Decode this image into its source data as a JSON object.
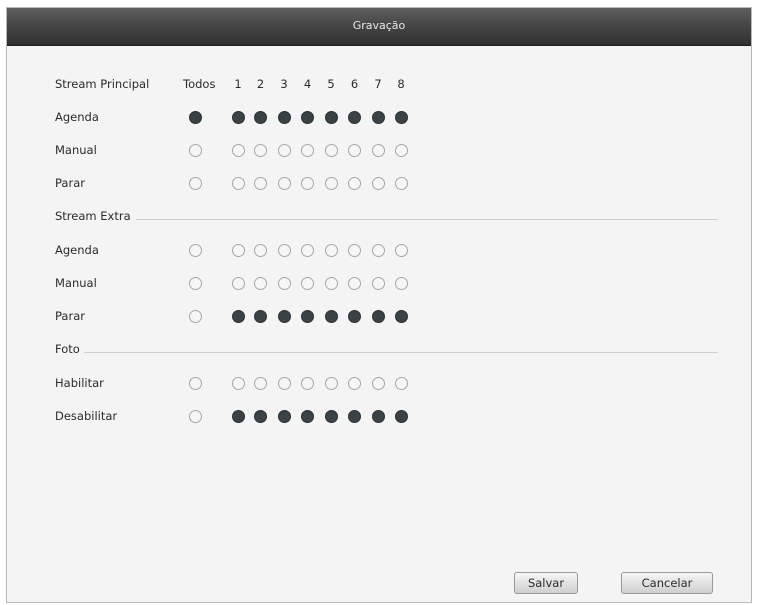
{
  "window": {
    "title": "Gravação"
  },
  "header": {
    "stream_label": "Stream Principal",
    "todos_label": "Todos",
    "channels": [
      "1",
      "2",
      "3",
      "4",
      "5",
      "6",
      "7",
      "8"
    ]
  },
  "main_stream": {
    "rows": [
      {
        "label": "Agenda",
        "todos": true,
        "channels": [
          true,
          true,
          true,
          true,
          true,
          true,
          true,
          true
        ]
      },
      {
        "label": "Manual",
        "todos": false,
        "channels": [
          false,
          false,
          false,
          false,
          false,
          false,
          false,
          false
        ]
      },
      {
        "label": "Parar",
        "todos": false,
        "channels": [
          false,
          false,
          false,
          false,
          false,
          false,
          false,
          false
        ]
      }
    ]
  },
  "extra_stream": {
    "section_label": "Stream Extra",
    "rows": [
      {
        "label": "Agenda",
        "todos": false,
        "channels": [
          false,
          false,
          false,
          false,
          false,
          false,
          false,
          false
        ]
      },
      {
        "label": "Manual",
        "todos": false,
        "channels": [
          false,
          false,
          false,
          false,
          false,
          false,
          false,
          false
        ]
      },
      {
        "label": "Parar",
        "todos": false,
        "channels": [
          true,
          true,
          true,
          true,
          true,
          true,
          true,
          true
        ]
      }
    ]
  },
  "photo": {
    "section_label": "Foto",
    "rows": [
      {
        "label": "Habilitar",
        "todos": false,
        "channels": [
          false,
          false,
          false,
          false,
          false,
          false,
          false,
          false
        ]
      },
      {
        "label": "Desabilitar",
        "todos": false,
        "channels": [
          true,
          true,
          true,
          true,
          true,
          true,
          true,
          true
        ]
      }
    ]
  },
  "footer": {
    "save_label": "Salvar",
    "cancel_label": "Cancelar"
  }
}
